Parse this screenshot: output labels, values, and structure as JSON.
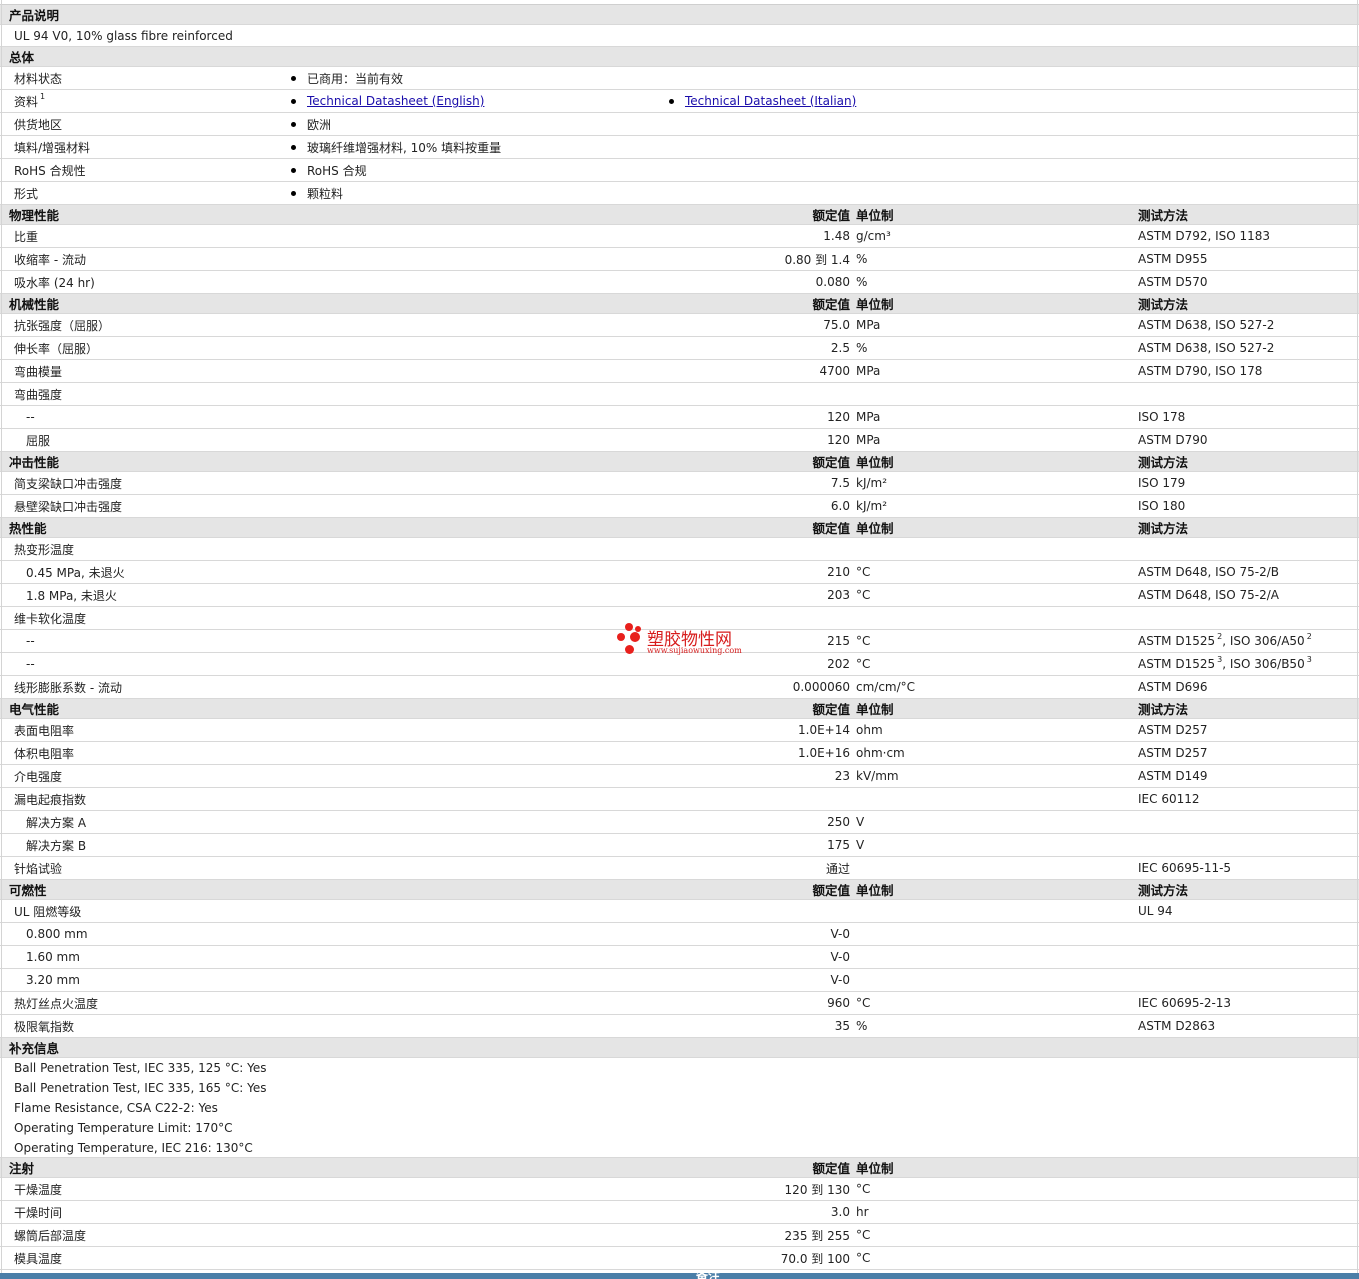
{
  "sections": [
    {
      "key": "desc",
      "title": "产品说明",
      "notes": [
        "UL 94 V0, 10% glass fibre reinforced"
      ]
    },
    {
      "key": "general",
      "title": "总体",
      "rows": [
        {
          "name": "材料状态",
          "items": [
            "已商用：当前有效"
          ]
        },
        {
          "name": "资料",
          "sup": "1",
          "links": [
            "Technical Datasheet (English)",
            "Technical Datasheet (Italian)"
          ]
        },
        {
          "name": "供货地区",
          "items": [
            "欧洲"
          ]
        },
        {
          "name": "填料/增强材料",
          "items": [
            "玻璃纤维增强材料, 10% 填料按重量"
          ]
        },
        {
          "name": "RoHS 合规性",
          "items": [
            "RoHS 合规"
          ]
        },
        {
          "name": "形式",
          "items": [
            "颗粒料"
          ]
        }
      ]
    },
    {
      "key": "physical",
      "title": "物理性能",
      "hdr": true,
      "rows": [
        {
          "name": "比重",
          "value": "1.48",
          "unit": "g/cm³",
          "test": "ASTM D792, ISO 1183"
        },
        {
          "name": "收缩率 - 流动",
          "value": "0.80 到  1.4",
          "unit": "%",
          "test": "ASTM D955"
        },
        {
          "name": "吸水率 (24 hr)",
          "value": "0.080",
          "unit": "%",
          "test": "ASTM D570"
        }
      ]
    },
    {
      "key": "mechanical",
      "title": "机械性能",
      "hdr": true,
      "rows": [
        {
          "name": "抗张强度（屈服）",
          "value": "75.0",
          "unit": "MPa",
          "test": "ASTM D638, ISO 527-2"
        },
        {
          "name": "伸长率（屈服）",
          "value": "2.5",
          "unit": "%",
          "test": "ASTM D638, ISO 527-2"
        },
        {
          "name": "弯曲模量",
          "value": "4700",
          "unit": "MPa",
          "test": "ASTM D790, ISO 178"
        },
        {
          "name": "弯曲强度"
        },
        {
          "name": "--",
          "sub": true,
          "value": "120",
          "unit": "MPa",
          "test": "ISO 178"
        },
        {
          "name": "屈服",
          "sub": true,
          "value": "120",
          "unit": "MPa",
          "test": "ASTM D790"
        }
      ]
    },
    {
      "key": "impact",
      "title": "冲击性能",
      "hdr": true,
      "rows": [
        {
          "name": "简支梁缺口冲击强度",
          "value": "7.5",
          "unit": "kJ/m²",
          "test": "ISO 179"
        },
        {
          "name": "悬壁梁缺口冲击强度",
          "value": "6.0",
          "unit": "kJ/m²",
          "test": "ISO 180"
        }
      ]
    },
    {
      "key": "thermal",
      "title": "热性能",
      "hdr": true,
      "rows": [
        {
          "name": "热变形温度"
        },
        {
          "name": "0.45 MPa, 未退火",
          "sub": true,
          "value": "210",
          "unit": "°C",
          "test": "ASTM D648, ISO 75-2/B"
        },
        {
          "name": "1.8 MPa, 未退火",
          "sub": true,
          "value": "203",
          "unit": "°C",
          "test": "ASTM D648, ISO 75-2/A"
        },
        {
          "name": "维卡软化温度"
        },
        {
          "name": "--",
          "sub": true,
          "value": "215",
          "unit": "°C",
          "test": "ASTM D1525",
          "test_sup": "2",
          "test2": ", ISO 306/A50",
          "test2_sup": "2"
        },
        {
          "name": "--",
          "sub": true,
          "value": "202",
          "unit": "°C",
          "test": "ASTM D1525",
          "test_sup": "3",
          "test2": ", ISO 306/B50",
          "test2_sup": "3"
        },
        {
          "name": "线形膨胀系数 - 流动",
          "value": "0.000060",
          "unit": "cm/cm/°C",
          "test": "ASTM D696"
        }
      ]
    },
    {
      "key": "electrical",
      "title": "电气性能",
      "hdr": true,
      "rows": [
        {
          "name": "表面电阻率",
          "value": "1.0E+14",
          "unit": "ohm",
          "test": "ASTM D257"
        },
        {
          "name": "体积电阻率",
          "value": "1.0E+16",
          "unit": "ohm·cm",
          "test": "ASTM D257"
        },
        {
          "name": "介电强度",
          "value": "23",
          "unit": "kV/mm",
          "test": "ASTM D149"
        },
        {
          "name": "漏电起痕指数",
          "test": "IEC 60112"
        },
        {
          "name": "解决方案 A",
          "sub": true,
          "value": "250",
          "unit": "V"
        },
        {
          "name": "解决方案 B",
          "sub": true,
          "value": "175",
          "unit": "V"
        },
        {
          "name": "针焰试验",
          "value": "通过",
          "test": "IEC 60695-11-5"
        }
      ]
    },
    {
      "key": "flammability",
      "title": "可燃性",
      "hdr": true,
      "rows": [
        {
          "name": "UL 阻燃等级",
          "test": "UL 94"
        },
        {
          "name": "0.800 mm",
          "sub": true,
          "value": "V-0"
        },
        {
          "name": "1.60 mm",
          "sub": true,
          "value": "V-0"
        },
        {
          "name": "3.20 mm",
          "sub": true,
          "value": "V-0"
        },
        {
          "name": "热灯丝点火温度",
          "value": "960",
          "unit": "°C",
          "test": "IEC 60695-2-13"
        },
        {
          "name": "极限氧指数",
          "value": "35",
          "unit": "%",
          "test": "ASTM D2863"
        }
      ]
    },
    {
      "key": "supplementary",
      "title": "补充信息",
      "notes": [
        "Ball Penetration Test, IEC 335, 125 °C: Yes",
        "Ball Penetration Test, IEC 335, 165 °C: Yes",
        "Flame Resistance, CSA C22-2: Yes",
        "Operating Temperature Limit: 170°C",
        "Operating Temperature, IEC 216: 130°C"
      ]
    },
    {
      "key": "injection",
      "title": "注射",
      "hdr": true,
      "hdr_no_test": true,
      "rows": [
        {
          "name": "干燥温度",
          "value": "120 到  130",
          "unit": "°C"
        },
        {
          "name": "干燥时间",
          "value": "3.0",
          "unit": "hr"
        },
        {
          "name": "螺筒后部温度",
          "value": "235 到  255",
          "unit": "°C"
        },
        {
          "name": "模具温度",
          "value": "70.0 到  100",
          "unit": "°C"
        }
      ]
    }
  ],
  "header_labels": {
    "value": "额定值",
    "unit": "单位制",
    "test": "测试方法"
  },
  "watermark": {
    "title": "塑胶物性网",
    "url": "www.sujiaowuxing.com"
  },
  "footer": {
    "label": "备注"
  }
}
